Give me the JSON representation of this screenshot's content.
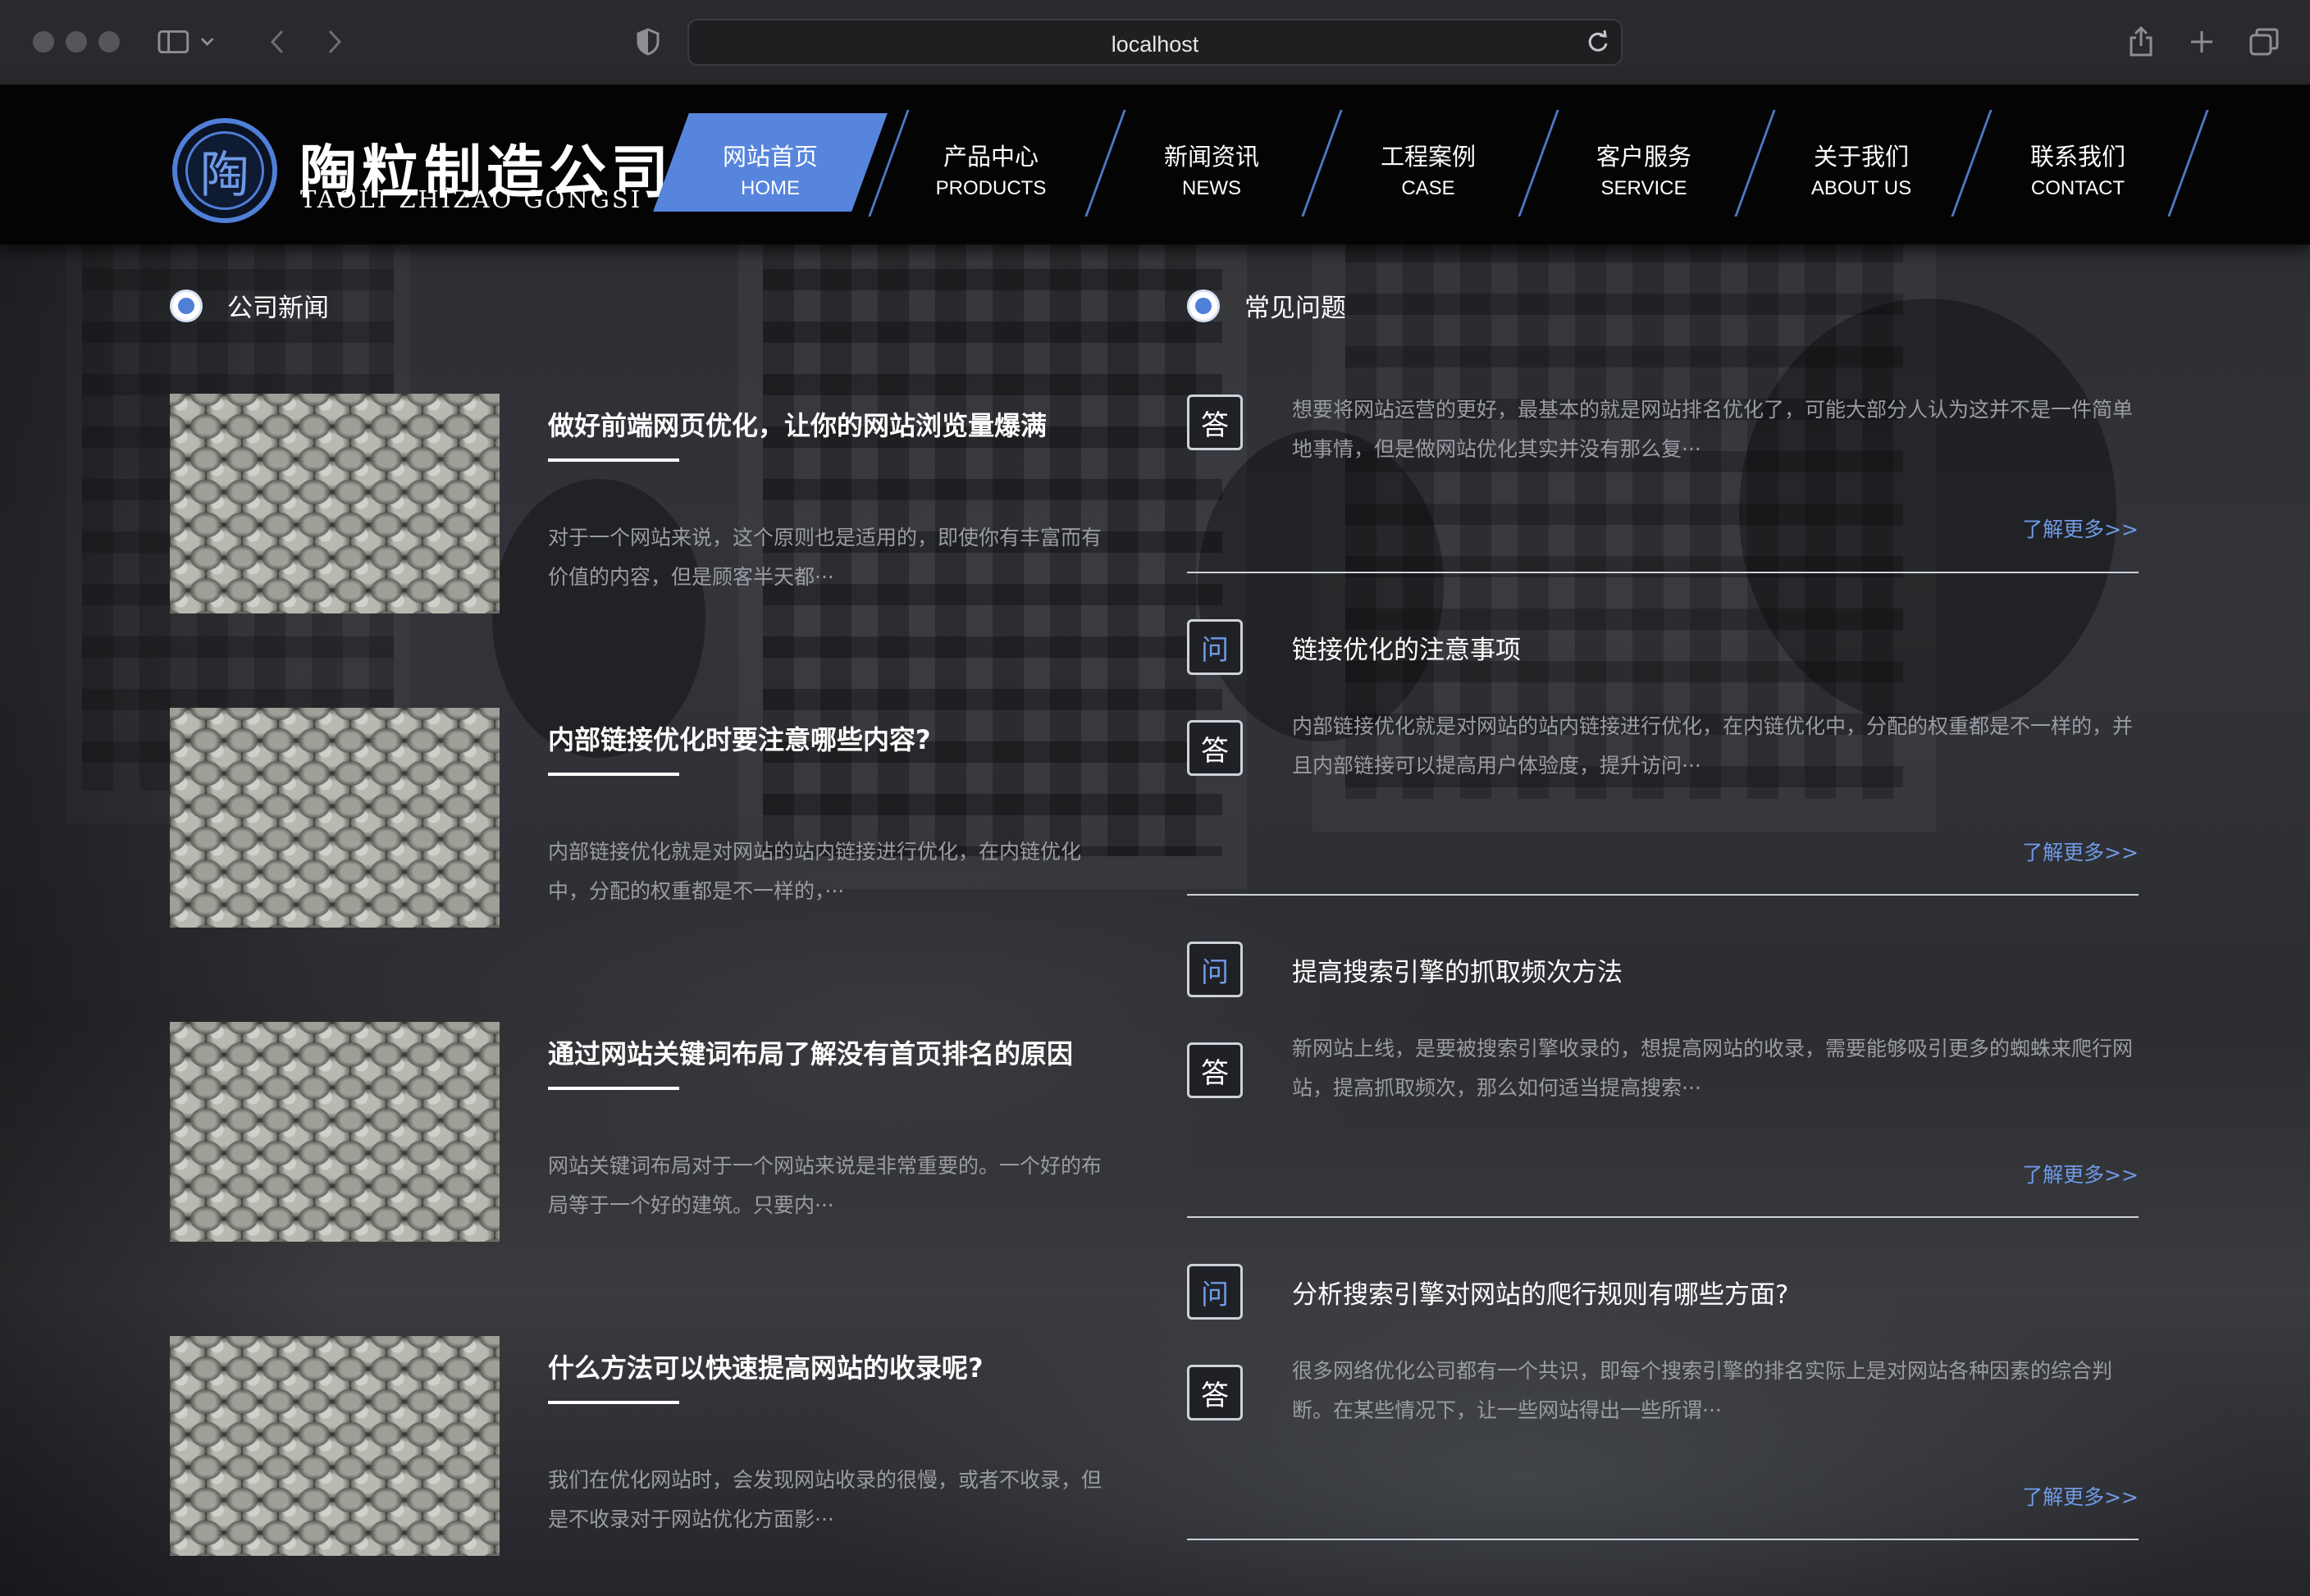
{
  "browser": {
    "url": "localhost"
  },
  "logo": {
    "badge_char": "陶",
    "name_cn": "陶粒制造公司",
    "name_en": "TAOLI ZHIZAO GONGSI"
  },
  "nav": [
    {
      "cn": "网站首页",
      "en": "HOME",
      "active": true
    },
    {
      "cn": "产品中心",
      "en": "PRODUCTS"
    },
    {
      "cn": "新闻资讯",
      "en": "NEWS"
    },
    {
      "cn": "工程案例",
      "en": "CASE"
    },
    {
      "cn": "客户服务",
      "en": "SERVICE"
    },
    {
      "cn": "关于我们",
      "en": "ABOUT US"
    },
    {
      "cn": "联系我们",
      "en": "CONTACT"
    }
  ],
  "news_section": {
    "title": "公司新闻",
    "items": [
      {
        "title": "做好前端网页优化，让你的网站浏览量爆满",
        "desc": "对于一个网站来说，这个原则也是适用的，即使你有丰富而有价值的内容，但是顾客半天都···"
      },
      {
        "title": "内部链接优化时要注意哪些内容?",
        "desc": "内部链接优化就是对网站的站内链接进行优化，在内链优化中，分配的权重都是不一样的，···"
      },
      {
        "title": "通过网站关键词布局了解没有首页排名的原因",
        "desc": "网站关键词布局对于一个网站来说是非常重要的。一个好的布局等于一个好的建筑。只要内···"
      },
      {
        "title": "什么方法可以快速提高网站的收录呢?",
        "desc": "我们在优化网站时，会发现网站收录的很慢，或者不收录，但是不收录对于网站优化方面影···"
      }
    ]
  },
  "faq_section": {
    "title": "常见问题",
    "q_label": "问",
    "a_label": "答",
    "more_label": "了解更多>>",
    "items": [
      {
        "question": "",
        "answer": "想要将网站运营的更好，最基本的就是网站排名优化了，可能大部分人认为这并不是一件简单地事情，但是做网站优化其实并没有那么复···"
      },
      {
        "question": "链接优化的注意事项",
        "answer": "内部链接优化就是对网站的站内链接进行优化，在内链优化中，分配的权重都是不一样的，并且内部链接可以提高用户体验度，提升访问···"
      },
      {
        "question": "提高搜索引擎的抓取频次方法",
        "answer": "新网站上线，是要被搜索引擎收录的，想提高网站的收录，需要能够吸引更多的蜘蛛来爬行网站，提高抓取频次，那么如何适当提高搜索···"
      },
      {
        "question": "分析搜索引擎对网站的爬行规则有哪些方面?",
        "answer": "很多网络优化公司都有一个共识，即每个搜索引擎的排名实际上是对网站各种因素的综合判断。在某些情况下，让一些网站得出一些所谓···"
      }
    ]
  }
}
